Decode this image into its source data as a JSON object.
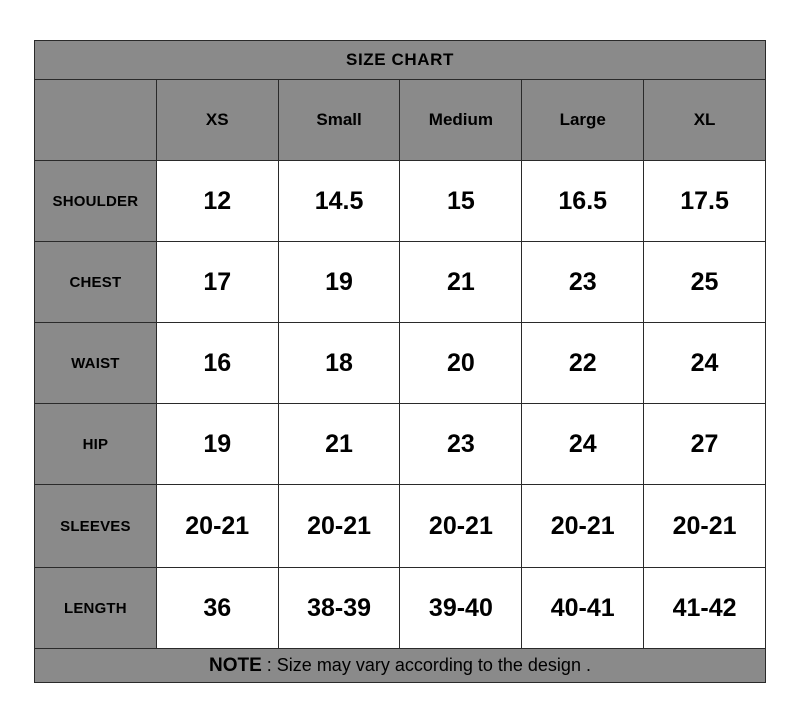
{
  "title": "SIZE CHART",
  "note": {
    "label": "NOTE",
    "text": " : Size may vary according to the design ."
  },
  "chart_data": {
    "type": "table",
    "title": "SIZE CHART",
    "corner_label": "",
    "columns": [
      "XS",
      "Small",
      "Medium",
      "Large",
      "XL"
    ],
    "row_headers": [
      "SHOULDER",
      "CHEST",
      "WAIST",
      "HIP",
      "SLEEVES",
      "LENGTH"
    ],
    "rows": [
      {
        "label": "SHOULDER",
        "values": [
          "12",
          "14.5",
          "15",
          "16.5",
          "17.5"
        ]
      },
      {
        "label": "CHEST",
        "values": [
          "17",
          "19",
          "21",
          "23",
          "25"
        ]
      },
      {
        "label": "WAIST",
        "values": [
          "16",
          "18",
          "20",
          "22",
          "24"
        ]
      },
      {
        "label": "HIP",
        "values": [
          "19",
          "21",
          "23",
          "24",
          "27"
        ]
      },
      {
        "label": "SLEEVES",
        "values": [
          "20-21",
          "20-21",
          "20-21",
          "20-21",
          "20-21"
        ]
      },
      {
        "label": "LENGTH",
        "values": [
          "36",
          "38-39",
          "39-40",
          "40-41",
          "41-42"
        ]
      }
    ],
    "footnote": "NOTE : Size may vary according to the design .",
    "colors": {
      "header_background": "#8a8a8a",
      "cell_background": "#ffffff",
      "border": "#2a2a2a",
      "text": "#000000",
      "page_background": "#ffffff"
    }
  }
}
